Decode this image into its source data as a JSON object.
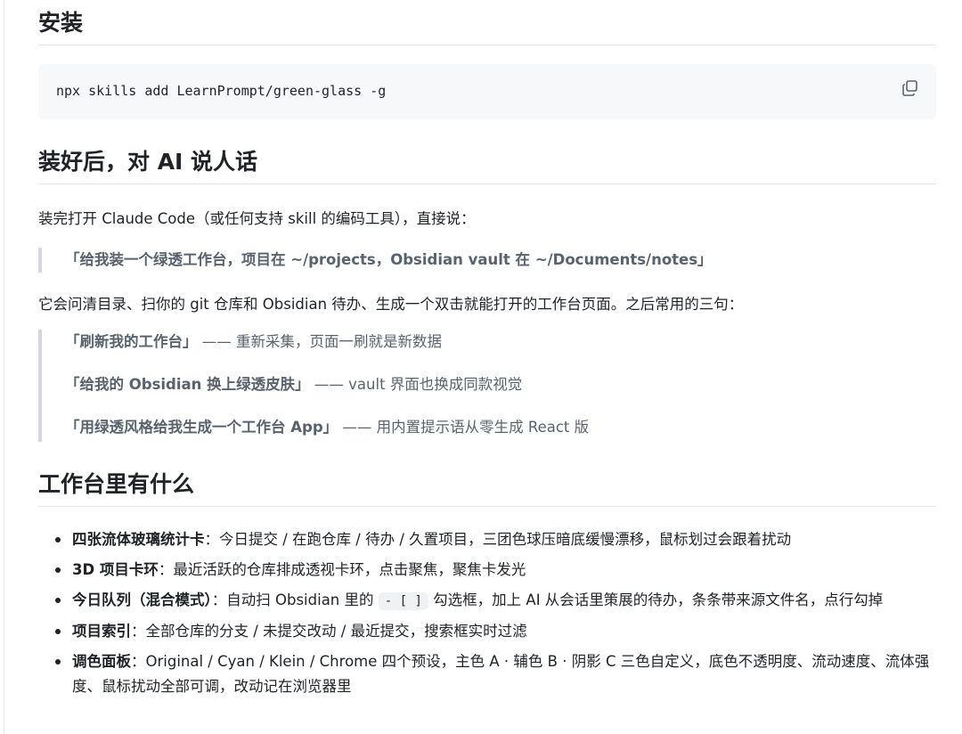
{
  "sections": {
    "install": {
      "heading": "安装",
      "command": "npx skills add LearnPrompt/green-glass -g",
      "copy_icon": "copy-icon"
    },
    "talk": {
      "heading": "装好后，对 AI 说人话",
      "intro": "装完打开 Claude Code（或任何支持 skill 的编码工具），直接说：",
      "quote": "「给我装一个绿透工作台，项目在 ~/projects，Obsidian vault 在 ~/Documents/notes」",
      "after": "它会问清目录、扫你的 git 仓库和 Obsidian 待办、生成一个双击就能打开的工作台页面。之后常用的三句：",
      "phrases": [
        {
          "cmd": "「刷新我的工作台」",
          "desc": " —— 重新采集，页面一刷就是新数据"
        },
        {
          "cmd": "「给我的 Obsidian 换上绿透皮肤」",
          "desc": " —— vault 界面也换成同款视觉"
        },
        {
          "cmd": "「用绿透风格给我生成一个工作台 App」",
          "desc": " —— 用内置提示语从零生成 React 版"
        }
      ]
    },
    "features": {
      "heading": "工作台里有什么",
      "items": [
        {
          "term": "四张流体玻璃统计卡",
          "text": "：今日提交 / 在跑仓库 / 待办 / 久置项目，三团色球压暗底缓慢漂移，鼠标划过会跟着扰动"
        },
        {
          "term": "3D 项目卡环",
          "text": "：最近活跃的仓库排成透视卡环，点击聚焦，聚焦卡发光"
        },
        {
          "term": "今日队列（混合模式）",
          "text_before": "：自动扫 Obsidian 里的 ",
          "code": "- [ ]",
          "text_after": " 勾选框，加上 AI 从会话里策展的待办，条条带来源文件名，点行勾掉"
        },
        {
          "term": "项目索引",
          "text": "：全部仓库的分支 / 未提交改动 / 最近提交，搜索框实时过滤"
        },
        {
          "term": "调色面板",
          "text": "：Original / Cyan / Klein / Chrome 四个预设，主色 A · 辅色 B · 阴影 C 三色自定义，底色不透明度、流动速度、流体强度、鼠标扰动全部可调，改动记在浏览器里"
        }
      ]
    }
  }
}
